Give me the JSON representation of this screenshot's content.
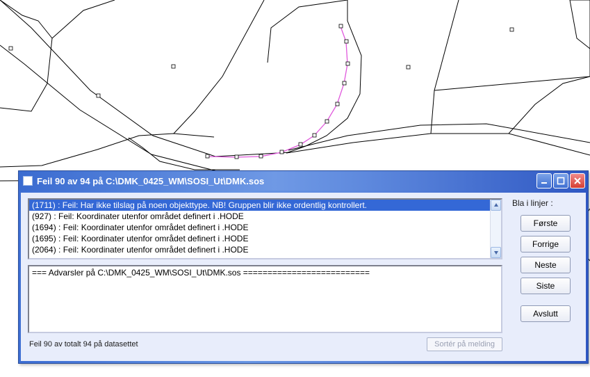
{
  "dialog": {
    "title": "Feil 90 av 94 på C:\\DMK_0425_WM\\SOSI_Ut\\DMK.sos",
    "status": "Feil 90 av totalt 94 på datasettet",
    "sort_label": "Sortér på melding",
    "warnings_text": "=== Advarsler på C:\\DMK_0425_WM\\SOSI_Ut\\DMK.sos ==========================",
    "list": [
      "(1711) : Feil: Har ikke tilslag på noen objekttype. NB! Gruppen blir ikke ordentlig kontrollert.",
      "(927) : Feil: Koordinater utenfor området definert i .HODE",
      "(1694) : Feil: Koordinater utenfor området definert i .HODE",
      "(1695) : Feil: Koordinater utenfor området definert i .HODE",
      "(2064) : Feil: Koordinater utenfor området definert i .HODE"
    ],
    "selected_index": 0
  },
  "sidebar": {
    "label": "Bla i linjer :",
    "buttons": {
      "first": "Første",
      "prev": "Forrige",
      "next": "Neste",
      "last": "Siste",
      "close": "Avslutt"
    }
  }
}
